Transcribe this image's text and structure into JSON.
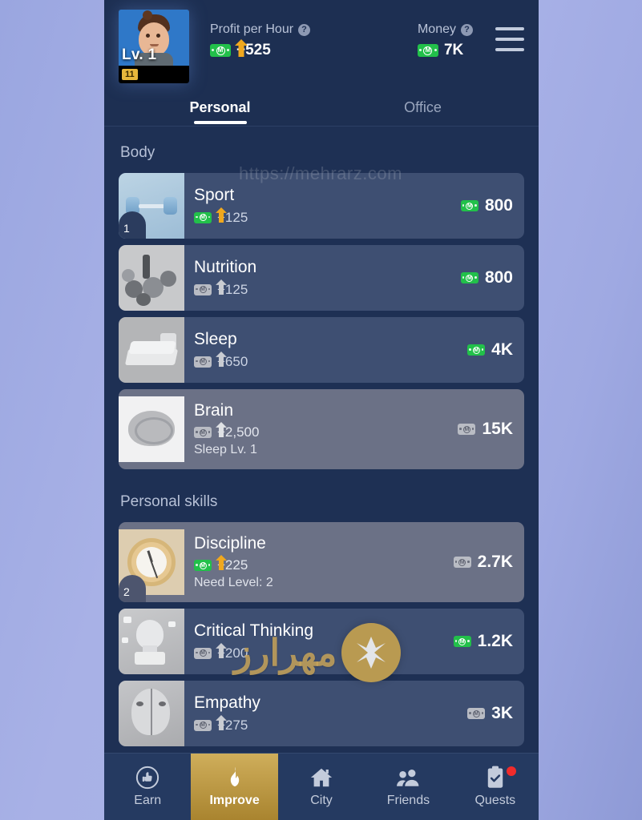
{
  "watermark": {
    "url": "https://mehrarz.com",
    "brand_fa": "مهرارز"
  },
  "header": {
    "avatar": {
      "level_text": "Lv. 1",
      "badge": "11"
    },
    "profit": {
      "label": "Profit per Hour",
      "help_icon": "question-mark-icon",
      "value": "+525",
      "currency_icon": "money-bill-up-icon"
    },
    "money": {
      "label": "Money",
      "help_icon": "question-mark-icon",
      "value": "7K",
      "currency_icon": "money-bill-icon"
    },
    "menu_icon": "hamburger-menu-icon"
  },
  "tabs": [
    {
      "label": "Personal",
      "active": true
    },
    {
      "label": "Office",
      "active": false
    }
  ],
  "sections": [
    {
      "title": "Body",
      "items": [
        {
          "name": "Sport",
          "profit": "+125",
          "profit_currency": "green",
          "price": "800",
          "price_currency": "green",
          "level_badge": "1",
          "requirement": null,
          "locked": false,
          "art": "art-sport"
        },
        {
          "name": "Nutrition",
          "profit": "+125",
          "profit_currency": "gray",
          "price": "800",
          "price_currency": "green",
          "level_badge": null,
          "requirement": null,
          "locked": false,
          "art": "art-nutrition"
        },
        {
          "name": "Sleep",
          "profit": "+650",
          "profit_currency": "gray",
          "price": "4K",
          "price_currency": "green",
          "level_badge": null,
          "requirement": null,
          "locked": false,
          "art": "art-sleep"
        },
        {
          "name": "Brain",
          "profit": "+2,500",
          "profit_currency": "gray",
          "price": "15K",
          "price_currency": "gray",
          "level_badge": null,
          "requirement": "Sleep Lv. 1",
          "locked": true,
          "art": "art-brain"
        }
      ]
    },
    {
      "title": "Personal skills",
      "items": [
        {
          "name": "Discipline",
          "profit": "+225",
          "profit_currency": "green",
          "price": "2.7K",
          "price_currency": "gray",
          "level_badge": "2",
          "requirement": "Need Level: 2",
          "locked": true,
          "art": "art-disc"
        },
        {
          "name": "Critical Thinking",
          "profit": "+200",
          "profit_currency": "gray",
          "price": "1.2K",
          "price_currency": "green",
          "level_badge": null,
          "requirement": null,
          "locked": false,
          "art": "art-crit"
        },
        {
          "name": "Empathy",
          "profit": "+275",
          "profit_currency": "gray",
          "price": "3K",
          "price_currency": "gray",
          "level_badge": null,
          "requirement": null,
          "locked": false,
          "art": "art-emp"
        }
      ]
    }
  ],
  "bottom_nav": [
    {
      "label": "Earn",
      "icon": "thumbs-up-icon",
      "active": false,
      "badge": false
    },
    {
      "label": "Improve",
      "icon": "flame-icon",
      "active": true,
      "badge": false
    },
    {
      "label": "City",
      "icon": "home-icon",
      "active": false,
      "badge": false
    },
    {
      "label": "Friends",
      "icon": "people-icon",
      "active": false,
      "badge": false
    },
    {
      "label": "Quests",
      "icon": "clipboard-check-icon",
      "active": false,
      "badge": true
    }
  ],
  "colors": {
    "app_bg": "#1e3054",
    "header_bg": "#1d2f52",
    "row_bg": "#3e4f72",
    "row_locked_bg": "#6b7186",
    "accent_gold": "#cfae5b",
    "money_green": "#22c04a",
    "badge_red": "#f02b2b"
  }
}
